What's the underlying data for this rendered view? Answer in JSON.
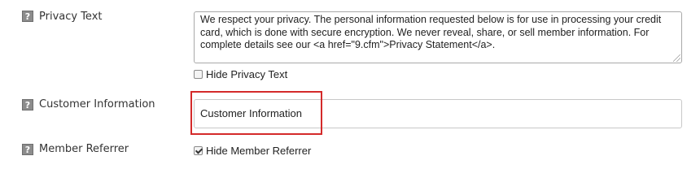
{
  "fields": {
    "privacy_text": {
      "help_glyph": "?",
      "label": "Privacy Text",
      "value": "We respect your privacy. The personal information requested below is for use in processing your credit card, which is done with secure encryption.  We never reveal, share, or sell member information. For complete details see our <a href=\"9.cfm\">Privacy Statement</a>.",
      "hide_label": "Hide Privacy Text",
      "hide_checked": false
    },
    "customer_information": {
      "help_glyph": "?",
      "label": "Customer Information",
      "value": "Customer Information"
    },
    "member_referrer": {
      "help_glyph": "?",
      "label": "Member Referrer",
      "hide_label": "Hide Member Referrer",
      "hide_checked": true
    }
  },
  "colors": {
    "highlight": "#d42a2a",
    "help_icon_bg": "#8c8c8c"
  },
  "icons": {
    "help": "help-icon",
    "checkbox_checked": "checkmark-icon"
  }
}
